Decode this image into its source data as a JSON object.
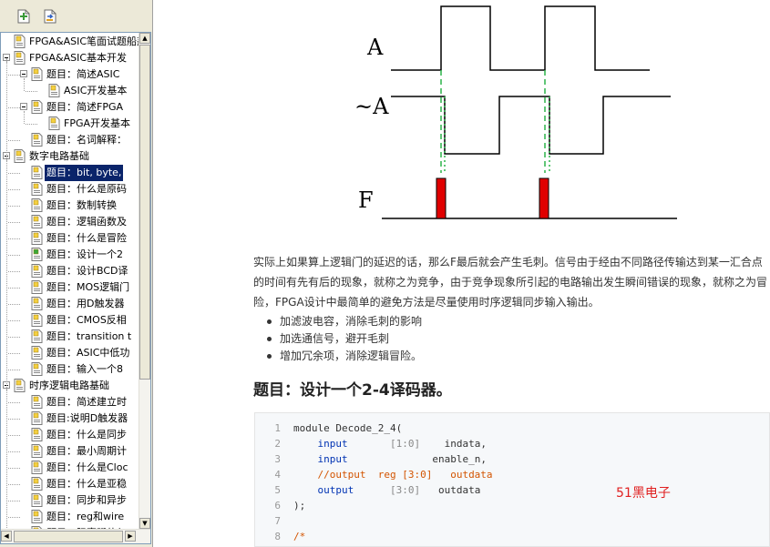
{
  "toolbar": {
    "buttons": [
      "add-page-icon",
      "import-page-icon"
    ]
  },
  "tree": [
    {
      "label": "FPGA&ASIC笔面试题船叢",
      "depth": 0,
      "expandable": false,
      "icon": "book-icon"
    },
    {
      "label": "FPGA&ASIC基本开发",
      "depth": 0,
      "expandable": true,
      "icon": "page-icon"
    },
    {
      "label": "题目：简述ASIC",
      "depth": 1,
      "expandable": true,
      "icon": "page-icon"
    },
    {
      "label": "ASIC开发基本",
      "depth": 2,
      "expandable": false,
      "icon": "page-icon"
    },
    {
      "label": "题目：简述FPGA",
      "depth": 1,
      "expandable": true,
      "icon": "page-icon"
    },
    {
      "label": "FPGA开发基本",
      "depth": 2,
      "expandable": false,
      "icon": "page-icon"
    },
    {
      "label": "题目：名词解释：",
      "depth": 1,
      "expandable": false,
      "icon": "page-icon"
    },
    {
      "label": "数字电路基础",
      "depth": 0,
      "expandable": true,
      "icon": "page-icon"
    },
    {
      "label": "题目：bit, byte,",
      "depth": 1,
      "expandable": false,
      "icon": "page-icon",
      "selected": true
    },
    {
      "label": "题目：什么是原码",
      "depth": 1,
      "expandable": false,
      "icon": "page-icon"
    },
    {
      "label": "题目：数制转换",
      "depth": 1,
      "expandable": false,
      "icon": "page-icon"
    },
    {
      "label": "题目：逻辑函数及",
      "depth": 1,
      "expandable": false,
      "icon": "page-icon"
    },
    {
      "label": "题目：什么是冒险",
      "depth": 1,
      "expandable": false,
      "icon": "page-icon"
    },
    {
      "label": "题目：设计一个2",
      "depth": 1,
      "expandable": false,
      "icon": "page-green-icon"
    },
    {
      "label": "题目：设计BCD译",
      "depth": 1,
      "expandable": false,
      "icon": "page-icon"
    },
    {
      "label": "题目：MOS逻辑门",
      "depth": 1,
      "expandable": false,
      "icon": "page-icon"
    },
    {
      "label": "题目：用D触发器",
      "depth": 1,
      "expandable": false,
      "icon": "page-icon"
    },
    {
      "label": "题目：CMOS反相",
      "depth": 1,
      "expandable": false,
      "icon": "page-icon"
    },
    {
      "label": "题目：transition t",
      "depth": 1,
      "expandable": false,
      "icon": "page-icon"
    },
    {
      "label": "题目：ASIC中低功",
      "depth": 1,
      "expandable": false,
      "icon": "page-icon"
    },
    {
      "label": "题目：输入一个8",
      "depth": 1,
      "expandable": false,
      "icon": "page-icon"
    },
    {
      "label": "时序逻辑电路基础",
      "depth": 0,
      "expandable": true,
      "icon": "page-icon"
    },
    {
      "label": "题目：简述建立时",
      "depth": 1,
      "expandable": false,
      "icon": "page-icon"
    },
    {
      "label": "题目:说明D触发器",
      "depth": 1,
      "expandable": false,
      "icon": "page-icon"
    },
    {
      "label": "题目：什么是同步",
      "depth": 1,
      "expandable": false,
      "icon": "page-icon"
    },
    {
      "label": "题目：最小周期计",
      "depth": 1,
      "expandable": false,
      "icon": "page-icon"
    },
    {
      "label": "题目：什么是Cloc",
      "depth": 1,
      "expandable": false,
      "icon": "page-icon"
    },
    {
      "label": "题目：什么是亚稳",
      "depth": 1,
      "expandable": false,
      "icon": "page-icon"
    },
    {
      "label": "题目：同步和异步",
      "depth": 1,
      "expandable": false,
      "icon": "page-icon"
    },
    {
      "label": "题目：reg和wire",
      "depth": 1,
      "expandable": false,
      "icon": "page-icon"
    },
    {
      "label": "题目：阻塞赋值与",
      "depth": 1,
      "expandable": false,
      "icon": "page-icon"
    }
  ],
  "diagram": {
    "label_a": "A",
    "label_not_a": "~A",
    "label_f": "F"
  },
  "paragraph": "实际上如果算上逻辑门的延迟的话，那么F最后就会产生毛刺。信号由于经由不同路径传输达到某一汇合点的时间有先有后的现象，就称之为竞争，由于竞争现象所引起的电路输出发生瞬间错误的现象，就称之为冒险，FPGA设计中最简单的避免方法是尽量使用时序逻辑同步输入输出。",
  "bullets": [
    "加滤波电容，消除毛刺的影响",
    "加选通信号，避开毛刺",
    "增加冗余项，消除逻辑冒险。"
  ],
  "heading": "题目：设计一个2-4译码器。",
  "code_lines": [
    {
      "n": "1",
      "parts": [
        [
          "",
          "module Decode_2_4("
        ]
      ]
    },
    {
      "n": "2",
      "parts": [
        [
          "",
          "    "
        ],
        [
          "kw",
          "input"
        ],
        [
          "",
          "       "
        ],
        [
          "dim",
          "[1:0]"
        ],
        [
          "",
          "    indata,"
        ]
      ]
    },
    {
      "n": "3",
      "parts": [
        [
          "",
          "    "
        ],
        [
          "kw",
          "input"
        ],
        [
          "",
          "              enable_n,"
        ]
      ]
    },
    {
      "n": "4",
      "parts": [
        [
          "",
          "    "
        ],
        [
          "cm",
          "//output  reg [3:0]   outdata"
        ]
      ]
    },
    {
      "n": "5",
      "parts": [
        [
          "",
          "    "
        ],
        [
          "kw",
          "output"
        ],
        [
          "",
          "      "
        ],
        [
          "dim",
          "[3:0]"
        ],
        [
          "",
          "   outdata"
        ]
      ]
    },
    {
      "n": "6",
      "parts": [
        [
          "",
          ");"
        ]
      ]
    },
    {
      "n": "7",
      "parts": [
        [
          "",
          ""
        ]
      ]
    },
    {
      "n": "8",
      "parts": [
        [
          "cm",
          "/*"
        ]
      ]
    }
  ],
  "watermark": "51黑电子",
  "colors": {
    "selection": "#0a246a",
    "pulse": "#e00000",
    "guide": "#2db34a"
  }
}
